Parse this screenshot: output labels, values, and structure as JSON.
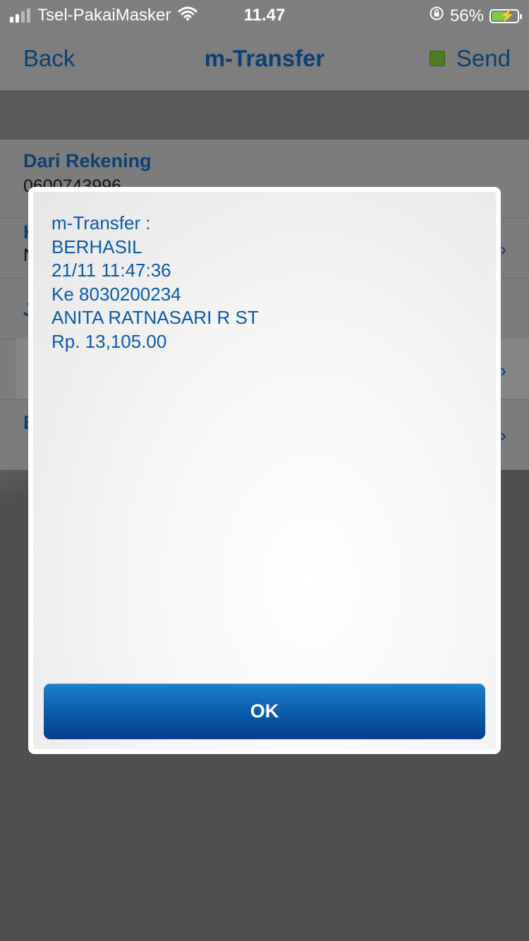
{
  "status_bar": {
    "carrier": "Tsel-PakaiMasker",
    "time": "11.47",
    "battery_percent": "56%",
    "battery_level": 0.56
  },
  "nav": {
    "back_label": "Back",
    "title": "m-Transfer",
    "send_label": "Send"
  },
  "form": {
    "rows": [
      {
        "label": "Dari Rekening",
        "value": "0600743996"
      },
      {
        "label": "K",
        "value": "N"
      },
      {
        "label": "J",
        "value": ""
      },
      {
        "label": "",
        "value": ""
      },
      {
        "label": "E",
        "value": ""
      }
    ]
  },
  "dialog": {
    "lines": [
      "m-Transfer :",
      "BERHASIL",
      "21/11 11:47:36",
      "Ke 8030200234",
      "ANITA RATNASARI R ST",
      "Rp. 13,105.00"
    ],
    "ok_label": "OK"
  },
  "colors": {
    "accent": "#0c3f73",
    "dialog_text": "#0c5aa6",
    "ok_button": "#0a5aa8"
  }
}
